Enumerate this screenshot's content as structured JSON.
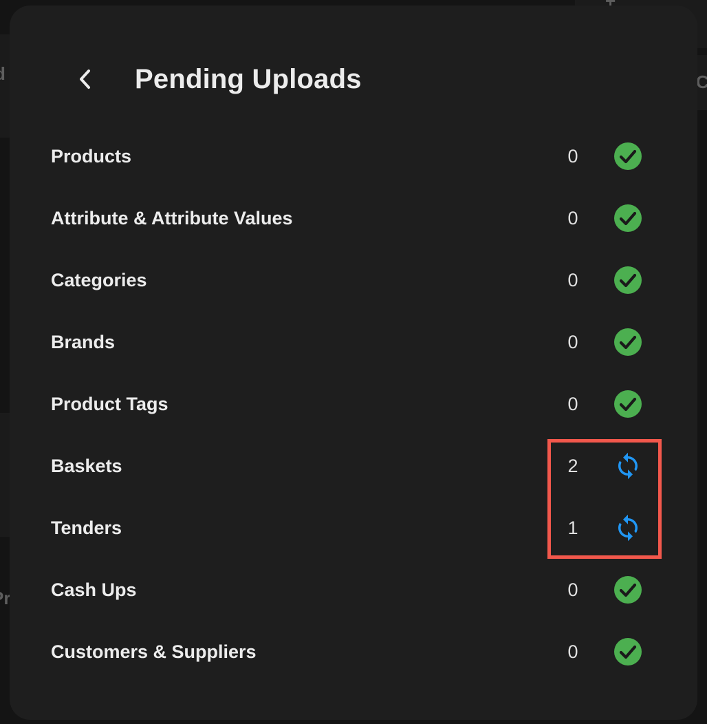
{
  "dialog": {
    "title": "Pending Uploads",
    "back_icon": "chevron-left-icon"
  },
  "rows": [
    {
      "label": "Products",
      "count": "0",
      "status": "synced",
      "icon": "check-circle-icon"
    },
    {
      "label": "Attribute & Attribute Values",
      "count": "0",
      "status": "synced",
      "icon": "check-circle-icon"
    },
    {
      "label": "Categories",
      "count": "0",
      "status": "synced",
      "icon": "check-circle-icon"
    },
    {
      "label": "Brands",
      "count": "0",
      "status": "synced",
      "icon": "check-circle-icon"
    },
    {
      "label": "Product Tags",
      "count": "0",
      "status": "synced",
      "icon": "check-circle-icon"
    },
    {
      "label": "Baskets",
      "count": "2",
      "status": "pending",
      "icon": "sync-icon"
    },
    {
      "label": "Tenders",
      "count": "1",
      "status": "pending",
      "icon": "sync-icon"
    },
    {
      "label": "Cash Ups",
      "count": "0",
      "status": "synced",
      "icon": "check-circle-icon"
    },
    {
      "label": "Customers & Suppliers",
      "count": "0",
      "status": "synced",
      "icon": "check-circle-icon"
    }
  ],
  "colors": {
    "synced": "#4caf50",
    "pending": "#2196f3",
    "highlight": "#f2584c",
    "modal_bg": "#1e1e1e"
  },
  "background_fragments": {
    "top_right": "+",
    "right_edge": "C",
    "left_edge_1": "d",
    "left_edge_2": "Pr"
  }
}
